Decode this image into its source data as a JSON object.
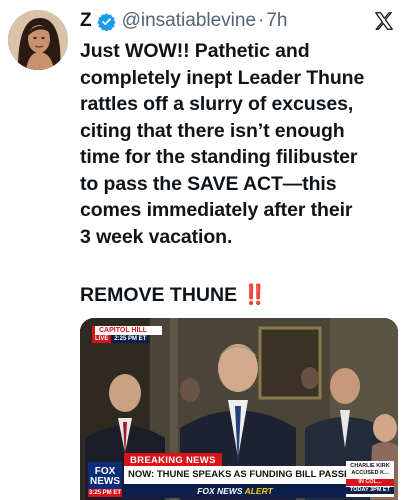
{
  "post": {
    "display_name": "Z",
    "handle": "@insatiablevine",
    "separator": "·",
    "time": "7h",
    "body_lines": "Just WOW!! Pathetic and\ncompletely inept Leader Thune\nrattles off a slurry of excuses,\nciting that there isn’t enough\ntime for the standing filibuster\nto pass the SAVE ACT—this\ncomes immediately after their\n3 week vacation.",
    "shout": "REMOVE THUNE",
    "shout_emoji": "‼️",
    "icons": {
      "avatar": "profile-photo",
      "verified": "verified-badge-icon",
      "platform": "x-logo-icon"
    },
    "accent_colors": {
      "verified": "#1d9bf0",
      "emoji": "#e0102b"
    }
  },
  "video": {
    "location": "CAPITOL HILL",
    "live": "LIVE",
    "live_time": "2:25 PM ET",
    "breaking": "BREAKING NEWS",
    "headline": "NOW: THUNE SPEAKS AS FUNDING BILL PASSES IN HOUSE",
    "sub_brand": "FOX NEWS",
    "sub_alert": "ALERT",
    "logo_line1": "FOX",
    "logo_line2": "NEWS",
    "logo_time": "3:25 PM ET",
    "side_line1": "CHARLIE KIRK",
    "side_line2": "ACCUSED K...",
    "side_line3": "IN COL...",
    "side_line4": "TODAY 3PM ET"
  }
}
